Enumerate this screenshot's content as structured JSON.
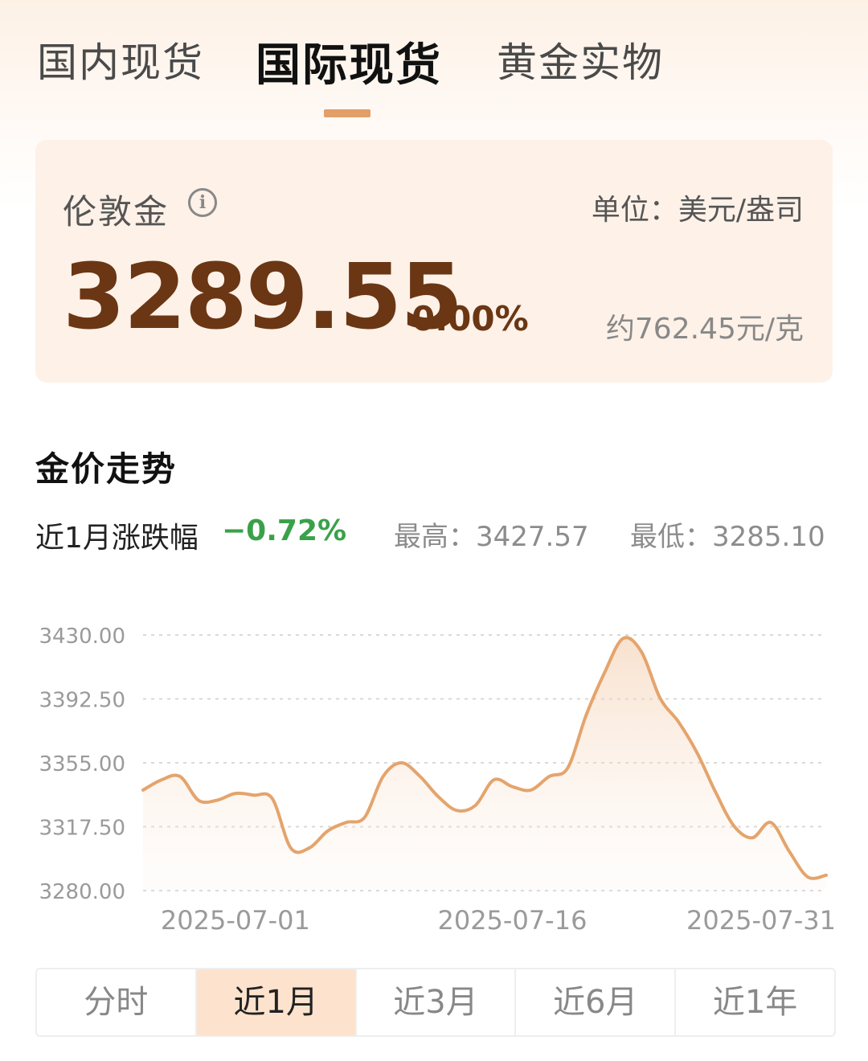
{
  "tabs": [
    {
      "label": "国内现货",
      "active": false
    },
    {
      "label": "国际现货",
      "active": true
    },
    {
      "label": "黄金实物",
      "active": false
    }
  ],
  "price_card": {
    "name": "伦敦金",
    "info_icon": "info-icon",
    "unit": "单位：美元/盎司",
    "price": "3289.55",
    "change": "0.00%",
    "per_gram": "约762.45元/克"
  },
  "trend": {
    "title": "金价走势",
    "range_label": "近1月涨跌幅",
    "range_change": "−0.72%",
    "high": "最高：3427.57",
    "low": "最低：3285.10"
  },
  "colors": {
    "accent": "#e29f67",
    "price_text": "#6a3614",
    "down_green": "#3aa14a",
    "active_period_bg": "#fde3cd"
  },
  "chart_data": {
    "type": "area",
    "y_ticks": [
      "3430.00",
      "3392.50",
      "3355.00",
      "3317.50",
      "3280.00"
    ],
    "ylim": [
      3280,
      3430
    ],
    "x_ticks": [
      {
        "label": "2025-07-01",
        "value": "2025-07-01"
      },
      {
        "label": "2025-07-16",
        "value": "2025-07-16"
      },
      {
        "label": "2025-07-31",
        "value": "2025-07-31"
      }
    ],
    "grid": true,
    "series": [
      {
        "x": [
          "2025-06-26",
          "2025-06-27",
          "2025-06-28",
          "2025-06-29",
          "2025-06-30",
          "2025-07-01",
          "2025-07-02",
          "2025-07-03",
          "2025-07-04",
          "2025-07-05",
          "2025-07-06",
          "2025-07-07",
          "2025-07-08",
          "2025-07-09",
          "2025-07-10",
          "2025-07-11",
          "2025-07-12",
          "2025-07-13",
          "2025-07-14",
          "2025-07-15",
          "2025-07-16",
          "2025-07-17",
          "2025-07-18",
          "2025-07-19",
          "2025-07-20",
          "2025-07-21",
          "2025-07-22",
          "2025-07-23",
          "2025-07-24",
          "2025-07-25",
          "2025-07-26",
          "2025-07-27",
          "2025-07-28",
          "2025-07-29",
          "2025-07-30",
          "2025-07-31",
          "2025-08-01",
          "2025-08-02"
        ],
        "values": [
          3339,
          3345,
          3347,
          3333,
          3333,
          3337,
          3336,
          3334,
          3305,
          3305,
          3315,
          3320,
          3323,
          3347,
          3355,
          3347,
          3335,
          3327,
          3330,
          3345,
          3341,
          3339,
          3347,
          3352,
          3383,
          3408,
          3428,
          3420,
          3393,
          3379,
          3361,
          3338,
          3318,
          3311,
          3320,
          3303,
          3288,
          3289
        ]
      }
    ]
  },
  "periods": [
    {
      "label": "分时",
      "active": false
    },
    {
      "label": "近1月",
      "active": true
    },
    {
      "label": "近3月",
      "active": false
    },
    {
      "label": "近6月",
      "active": false
    },
    {
      "label": "近1年",
      "active": false
    }
  ]
}
